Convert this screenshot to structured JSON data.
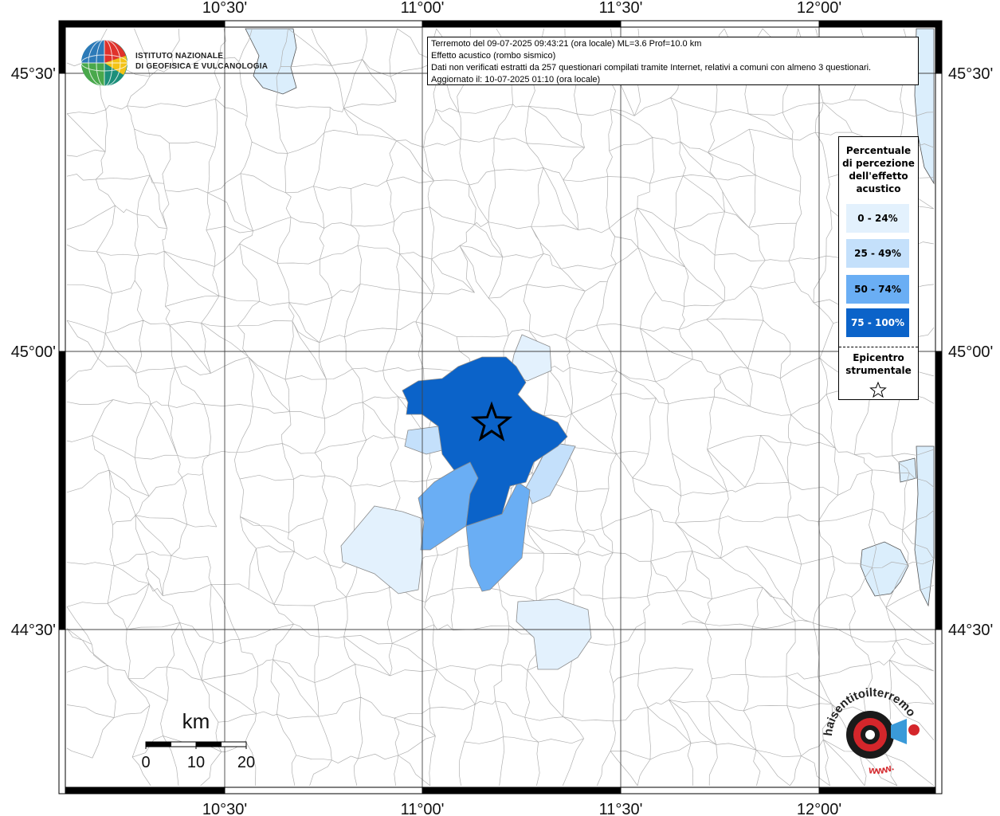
{
  "info": {
    "line1": "Terremoto del 09-07-2025 09:43:21 (ora locale) ML=3.6 Prof=10.0 km",
    "line2": "Effetto acustico (rombo sismico)",
    "line3": "Dati non verificati estratti da 257 questionari compilati tramite Internet, relativi a comuni con almeno 3 questionari.",
    "line4": "Aggiornato il: 10-07-2025 01:10 (ora locale)"
  },
  "axes": {
    "top": [
      "10°30'",
      "11°00'",
      "11°30'",
      "12°00'"
    ],
    "bottom": [
      "10°30'",
      "11°00'",
      "11°30'",
      "12°00'"
    ],
    "left": [
      "45°30'",
      "45°00'",
      "44°30'"
    ],
    "right": [
      "45°30'",
      "45°00'",
      "44°30'"
    ]
  },
  "legend": {
    "title_lines": [
      "Percentuale",
      "di percezione",
      "dell'effetto",
      "acustico"
    ],
    "classes": [
      {
        "label": "0 - 24%",
        "color": "#e3f1fd"
      },
      {
        "label": "25 - 49%",
        "color": "#c4e0fb"
      },
      {
        "label": "50 - 74%",
        "color": "#6aaef4"
      },
      {
        "label": "75 - 100%",
        "color": "#0b63c9"
      }
    ],
    "epicenter_lines": [
      "Epicentro",
      "strumentale"
    ]
  },
  "logo": {
    "ingv_line1": "ISTITUTO NAZIONALE",
    "ingv_line2": "DI GEOFISICA E VULCANOLOGIA",
    "hsit_text": "haisentitoilterremoto.it",
    "hsit_www": "www."
  },
  "scalebar": {
    "unit": "km",
    "ticks": [
      "0",
      "10",
      "20"
    ]
  },
  "colors": {
    "water": "#dbeefc",
    "grid": "#444444",
    "boundary": "#9a9a9a"
  }
}
